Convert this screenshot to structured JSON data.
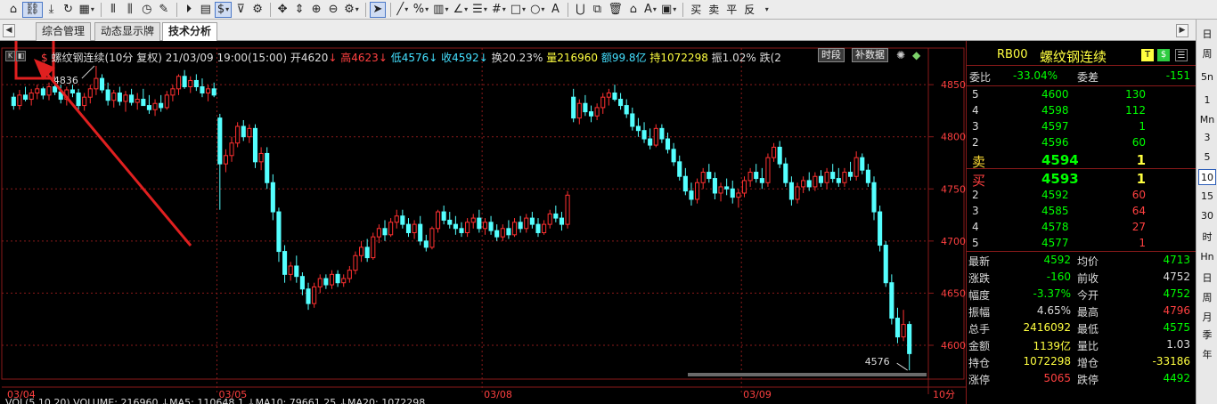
{
  "toolbar": {
    "text_buttons": [
      "买",
      "卖",
      "平",
      "反"
    ]
  },
  "tabs": [
    {
      "label": "综合管理"
    },
    {
      "label": "动态显示牌"
    },
    {
      "label": "技术分析"
    }
  ],
  "chart_info": {
    "name": "螺纹钢连续",
    "period_adj": "(10分 复权)",
    "datetime": "21/03/09 19:00(15:00)",
    "open": "开4620",
    "high": "高4623",
    "low": "低4576",
    "close": "收4592",
    "turnover": "换20.23%",
    "volume": "量216960",
    "amount": "额99.8亿",
    "hold": "持1072298",
    "amplitude": "振1.02%",
    "fall": "跌(2",
    "btn_period": "时段",
    "btn_supplement": "补数据"
  },
  "chart_data": {
    "type": "candlestick",
    "ylim": [
      4565,
      4880
    ],
    "y_ticks": [
      4850,
      4800,
      4750,
      4700,
      4650,
      4600
    ],
    "x_labels": [
      {
        "label": "03/04",
        "index": 0
      },
      {
        "label": "03/05",
        "index": 35
      },
      {
        "label": "03/08",
        "index": 80
      },
      {
        "label": "03/09",
        "index": 124
      }
    ],
    "period_label": "10分",
    "max_label": "4836",
    "min_label": "4576",
    "candles": [
      [
        4838,
        4842,
        4826,
        4830
      ],
      [
        4830,
        4845,
        4826,
        4840
      ],
      [
        4840,
        4848,
        4834,
        4836
      ],
      [
        4836,
        4846,
        4830,
        4842
      ],
      [
        4842,
        4850,
        4836,
        4846
      ],
      [
        4846,
        4848,
        4836,
        4840
      ],
      [
        4840,
        4852,
        4835,
        4848
      ],
      [
        4848,
        4858,
        4840,
        4843
      ],
      [
        4843,
        4850,
        4832,
        4836
      ],
      [
        4836,
        4848,
        4830,
        4845
      ],
      [
        4845,
        4850,
        4838,
        4842
      ],
      [
        4842,
        4846,
        4826,
        4830
      ],
      [
        4830,
        4842,
        4825,
        4838
      ],
      [
        4838,
        4850,
        4832,
        4846
      ],
      [
        4846,
        4868,
        4840,
        4856
      ],
      [
        4856,
        4860,
        4842,
        4845
      ],
      [
        4845,
        4852,
        4830,
        4835
      ],
      [
        4835,
        4845,
        4828,
        4842
      ],
      [
        4842,
        4848,
        4830,
        4834
      ],
      [
        4834,
        4844,
        4824,
        4840
      ],
      [
        4840,
        4846,
        4830,
        4833
      ],
      [
        4833,
        4842,
        4826,
        4836
      ],
      [
        4836,
        4846,
        4830,
        4830
      ],
      [
        4830,
        4840,
        4822,
        4826
      ],
      [
        4826,
        4836,
        4820,
        4832
      ],
      [
        4832,
        4840,
        4824,
        4828
      ],
      [
        4828,
        4844,
        4826,
        4840
      ],
      [
        4840,
        4850,
        4834,
        4846
      ],
      [
        4846,
        4860,
        4840,
        4858
      ],
      [
        4858,
        4864,
        4846,
        4848
      ],
      [
        4848,
        4858,
        4842,
        4854
      ],
      [
        4854,
        4860,
        4844,
        4848
      ],
      [
        4848,
        4856,
        4838,
        4842
      ],
      [
        4842,
        4850,
        4834,
        4846
      ],
      [
        4846,
        4852,
        4838,
        4840
      ],
      [
        4818,
        4822,
        4730,
        4774
      ],
      [
        4774,
        4788,
        4766,
        4782
      ],
      [
        4782,
        4800,
        4776,
        4794
      ],
      [
        4794,
        4814,
        4790,
        4810
      ],
      [
        4810,
        4816,
        4796,
        4800
      ],
      [
        4800,
        4812,
        4794,
        4808
      ],
      [
        4808,
        4812,
        4770,
        4776
      ],
      [
        4776,
        4790,
        4768,
        4784
      ],
      [
        4784,
        4790,
        4750,
        4756
      ],
      [
        4756,
        4764,
        4720,
        4728
      ],
      [
        4728,
        4732,
        4680,
        4690
      ],
      [
        4690,
        4696,
        4660,
        4668
      ],
      [
        4668,
        4680,
        4662,
        4676
      ],
      [
        4676,
        4686,
        4660,
        4666
      ],
      [
        4666,
        4670,
        4648,
        4654
      ],
      [
        4654,
        4660,
        4634,
        4640
      ],
      [
        4640,
        4660,
        4636,
        4656
      ],
      [
        4656,
        4668,
        4650,
        4664
      ],
      [
        4664,
        4668,
        4654,
        4658
      ],
      [
        4658,
        4672,
        4654,
        4668
      ],
      [
        4668,
        4672,
        4656,
        4660
      ],
      [
        4660,
        4668,
        4656,
        4664
      ],
      [
        4664,
        4676,
        4660,
        4672
      ],
      [
        4672,
        4690,
        4668,
        4686
      ],
      [
        4686,
        4700,
        4680,
        4694
      ],
      [
        4694,
        4702,
        4680,
        4684
      ],
      [
        4684,
        4708,
        4682,
        4704
      ],
      [
        4704,
        4716,
        4698,
        4712
      ],
      [
        4712,
        4720,
        4700,
        4706
      ],
      [
        4706,
        4722,
        4704,
        4718
      ],
      [
        4718,
        4730,
        4712,
        4724
      ],
      [
        4724,
        4730,
        4712,
        4716
      ],
      [
        4716,
        4722,
        4704,
        4708
      ],
      [
        4708,
        4720,
        4702,
        4716
      ],
      [
        4716,
        4724,
        4696,
        4700
      ],
      [
        4700,
        4706,
        4690,
        4694
      ],
      [
        4694,
        4714,
        4692,
        4712
      ],
      [
        4712,
        4730,
        4708,
        4728
      ],
      [
        4728,
        4734,
        4716,
        4720
      ],
      [
        4720,
        4728,
        4712,
        4716
      ],
      [
        4716,
        4724,
        4706,
        4712
      ],
      [
        4712,
        4718,
        4704,
        4708
      ],
      [
        4708,
        4722,
        4704,
        4718
      ],
      [
        4718,
        4726,
        4712,
        4722
      ],
      [
        4722,
        4730,
        4708,
        4712
      ],
      [
        4712,
        4722,
        4706,
        4718
      ],
      [
        4718,
        4724,
        4706,
        4710
      ],
      [
        4710,
        4716,
        4700,
        4704
      ],
      [
        4704,
        4716,
        4700,
        4712
      ],
      [
        4712,
        4720,
        4702,
        4706
      ],
      [
        4706,
        4722,
        4704,
        4718
      ],
      [
        4718,
        4724,
        4708,
        4712
      ],
      [
        4712,
        4726,
        4708,
        4722
      ],
      [
        4722,
        4728,
        4712,
        4716
      ],
      [
        4716,
        4722,
        4704,
        4708
      ],
      [
        4708,
        4720,
        4706,
        4716
      ],
      [
        4716,
        4730,
        4712,
        4726
      ],
      [
        4726,
        4734,
        4718,
        4722
      ],
      [
        4722,
        4728,
        4710,
        4716
      ],
      [
        4716,
        4748,
        4712,
        4744
      ],
      [
        4838,
        4846,
        4814,
        4818
      ],
      [
        4818,
        4836,
        4812,
        4832
      ],
      [
        4832,
        4840,
        4820,
        4824
      ],
      [
        4824,
        4830,
        4814,
        4820
      ],
      [
        4820,
        4832,
        4816,
        4828
      ],
      [
        4828,
        4842,
        4822,
        4838
      ],
      [
        4838,
        4846,
        4830,
        4842
      ],
      [
        4842,
        4850,
        4834,
        4836
      ],
      [
        4836,
        4842,
        4826,
        4830
      ],
      [
        4830,
        4836,
        4818,
        4822
      ],
      [
        4822,
        4828,
        4806,
        4810
      ],
      [
        4810,
        4818,
        4800,
        4806
      ],
      [
        4806,
        4814,
        4794,
        4798
      ],
      [
        4798,
        4808,
        4788,
        4792
      ],
      [
        4792,
        4812,
        4790,
        4808
      ],
      [
        4808,
        4812,
        4794,
        4798
      ],
      [
        4798,
        4804,
        4784,
        4788
      ],
      [
        4788,
        4794,
        4772,
        4776
      ],
      [
        4776,
        4782,
        4758,
        4762
      ],
      [
        4762,
        4770,
        4744,
        4748
      ],
      [
        4748,
        4756,
        4734,
        4740
      ],
      [
        4740,
        4760,
        4736,
        4756
      ],
      [
        4756,
        4770,
        4750,
        4766
      ],
      [
        4766,
        4774,
        4756,
        4760
      ],
      [
        4760,
        4766,
        4740,
        4746
      ],
      [
        4746,
        4756,
        4738,
        4752
      ],
      [
        4752,
        4760,
        4744,
        4750
      ],
      [
        4750,
        4758,
        4736,
        4742
      ],
      [
        4742,
        4750,
        4732,
        4746
      ],
      [
        4746,
        4762,
        4742,
        4758
      ],
      [
        4758,
        4770,
        4752,
        4766
      ],
      [
        4766,
        4774,
        4756,
        4760
      ],
      [
        4760,
        4770,
        4750,
        4756
      ],
      [
        4756,
        4784,
        4752,
        4780
      ],
      [
        4780,
        4794,
        4776,
        4790
      ],
      [
        4790,
        4796,
        4770,
        4774
      ],
      [
        4774,
        4780,
        4752,
        4756
      ],
      [
        4756,
        4762,
        4734,
        4740
      ],
      [
        4740,
        4756,
        4736,
        4752
      ],
      [
        4752,
        4762,
        4746,
        4758
      ],
      [
        4758,
        4766,
        4748,
        4752
      ],
      [
        4752,
        4766,
        4748,
        4762
      ],
      [
        4762,
        4768,
        4752,
        4756
      ],
      [
        4756,
        4770,
        4750,
        4766
      ],
      [
        4766,
        4774,
        4756,
        4760
      ],
      [
        4760,
        4770,
        4752,
        4756
      ],
      [
        4756,
        4770,
        4752,
        4766
      ],
      [
        4766,
        4776,
        4758,
        4762
      ],
      [
        4762,
        4786,
        4758,
        4780
      ],
      [
        4780,
        4784,
        4764,
        4768
      ],
      [
        4768,
        4774,
        4752,
        4756
      ],
      [
        4756,
        4762,
        4720,
        4728
      ],
      [
        4728,
        4734,
        4690,
        4696
      ],
      [
        4696,
        4700,
        4656,
        4660
      ],
      [
        4660,
        4668,
        4620,
        4626
      ],
      [
        4626,
        4636,
        4602,
        4608
      ],
      [
        4608,
        4634,
        4604,
        4620
      ],
      [
        4620,
        4623,
        4576,
        4592
      ]
    ]
  },
  "volume_line": {
    "text": "VOL(5,10,20)  VOLUME: 216960  ↓MA5: 110648.1  ↓MA10: 79661.25  ↓MA20: 1072298"
  },
  "quote": {
    "code": "RB00",
    "name": "螺纹钢连续",
    "badge_t": "T",
    "badge_s": "$",
    "wb_label": "委比",
    "wb_value": "-33.04%",
    "wc_label": "委差",
    "wc_value": "-151",
    "asks": [
      {
        "level": "5",
        "price": "4600",
        "vol": "130"
      },
      {
        "level": "4",
        "price": "4598",
        "vol": "112"
      },
      {
        "level": "3",
        "price": "4597",
        "vol": "1"
      },
      {
        "level": "2",
        "price": "4596",
        "vol": "60"
      },
      {
        "level": "卖",
        "price": "4594",
        "vol": "1"
      }
    ],
    "bids": [
      {
        "level": "买",
        "price": "4593",
        "vol": "1"
      },
      {
        "level": "2",
        "price": "4592",
        "vol": "60"
      },
      {
        "level": "3",
        "price": "4585",
        "vol": "64"
      },
      {
        "level": "4",
        "price": "4578",
        "vol": "27"
      },
      {
        "level": "5",
        "price": "4577",
        "vol": "1"
      }
    ],
    "stats": [
      {
        "l1": "最新",
        "v1": "4592",
        "c1": "#00ff00",
        "l2": "均价",
        "v2": "4713",
        "c2": "#00ff00"
      },
      {
        "l1": "涨跌",
        "v1": "-160",
        "c1": "#00ff00",
        "l2": "前收",
        "v2": "4752",
        "c2": "#dddddd"
      },
      {
        "l1": "幅度",
        "v1": "-3.37%",
        "c1": "#00ff00",
        "l2": "今开",
        "v2": "4752",
        "c2": "#00ff00"
      },
      {
        "l1": "振幅",
        "v1": "4.65%",
        "c1": "#dddddd",
        "l2": "最高",
        "v2": "4796",
        "c2": "#ff4040"
      },
      {
        "l1": "总手",
        "v1": "2416092",
        "c1": "#ffff40",
        "l2": "最低",
        "v2": "4575",
        "c2": "#00ff00"
      },
      {
        "l1": "金额",
        "v1": "1139亿",
        "c1": "#ffff40",
        "l2": "量比",
        "v2": "1.03",
        "c2": "#dddddd"
      },
      {
        "l1": "持仓",
        "v1": "1072298",
        "c1": "#ffff40",
        "l2": "增仓",
        "v2": "-33186",
        "c2": "#ffff40"
      },
      {
        "l1": "涨停",
        "v1": "5065",
        "c1": "#ff4040",
        "l2": "跌停",
        "v2": "4492",
        "c2": "#00ff00"
      }
    ]
  },
  "periods": [
    "日",
    "周",
    "5n",
    "1",
    "Mn",
    "3",
    "5",
    "10",
    "15",
    "30",
    "时",
    "Hn",
    "日",
    "周",
    "月",
    "季",
    "年"
  ],
  "colors": {
    "up": "#ff3030",
    "down": "#54ffff",
    "grid": "#8a1a1a",
    "annotation": "#e02020"
  }
}
